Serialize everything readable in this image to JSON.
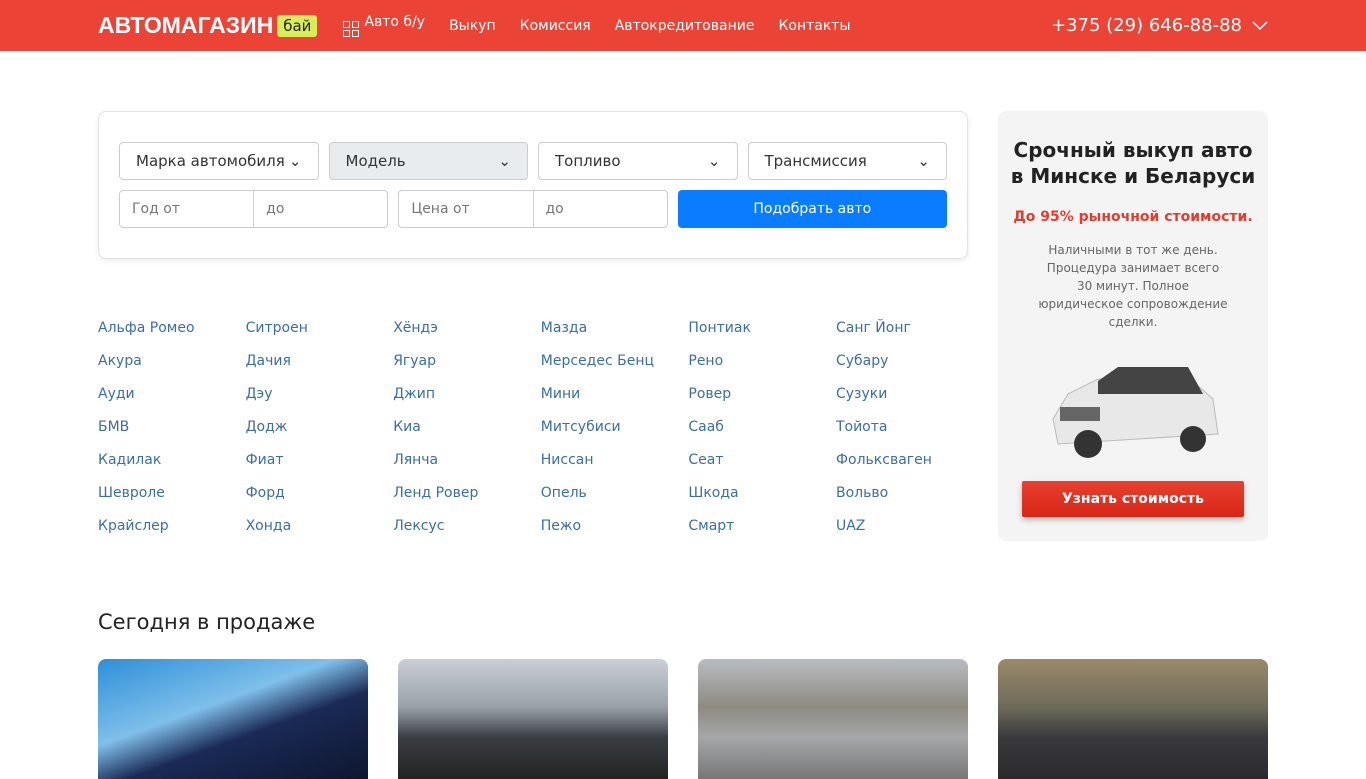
{
  "header": {
    "logo": "АВТОМАГАЗИН",
    "logo_badge": "бай",
    "nav": [
      "Авто б/у",
      "Выкуп",
      "Комиссия",
      "Автокредитование",
      "Контакты"
    ],
    "phone": "+375 (29) 646-88-88"
  },
  "filter": {
    "selects": [
      "Марка автомобиля",
      "Модель",
      "Топливо",
      "Трансмиссия"
    ],
    "year_from": "Год от",
    "year_to": "до",
    "price_from": "Цена от",
    "price_to": "до",
    "submit": "Подобрать авто"
  },
  "brands": [
    "Альфа Ромео",
    "Акура",
    "Ауди",
    "БМВ",
    "Кадилак",
    "Шевроле",
    "Крайслер",
    "Ситроен",
    "Дачия",
    "Дэу",
    "Додж",
    "Фиат",
    "Форд",
    "Хонда",
    "Хёндэ",
    "Ягуар",
    "Джип",
    "Киа",
    "Лянча",
    "Ленд Ровер",
    "Лексус",
    "Мазда",
    "Мерседес Бенц",
    "Мини",
    "Митсубиси",
    "Ниссан",
    "Опель",
    "Пежо",
    "Понтиак",
    "Рено",
    "Ровер",
    "Сааб",
    "Сеат",
    "Шкода",
    "Смарт",
    "Санг Йонг",
    "Субару",
    "Сузуки",
    "Тойота",
    "Фольксваген",
    "Вольво",
    "UAZ"
  ],
  "promo": {
    "title_1": "Срочный выкуп авто",
    "title_2": "в Минске и Беларуси",
    "highlight": "До 95% рыночной стоимости.",
    "text": "Наличными в тот же день. Процедура занимает всего 30 минут. Полное юридическое сопровождение сделки.",
    "button": "Узнать стоимость"
  },
  "today": {
    "title": "Сегодня в продаже"
  }
}
